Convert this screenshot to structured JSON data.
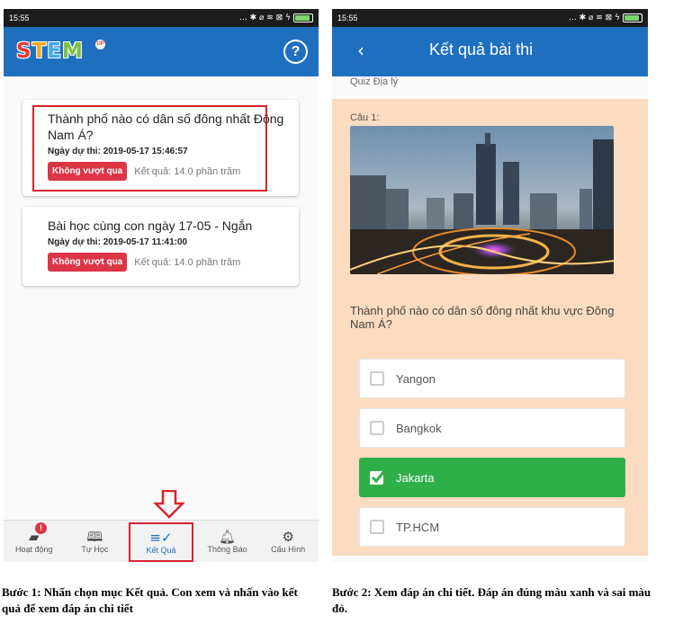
{
  "screen1": {
    "status_time": "15:55",
    "status_icons": "... ✱ ⌀ ≋ ⊠ ϟ",
    "logo_text": "STEM",
    "logo_badge": "UP",
    "help_icon_label": "?",
    "results": [
      {
        "title": "Thành phố nào có dân số đông nhất Đông Nam Á?",
        "date_label": "Ngày dự thi:",
        "date_value": "2019-05-17 15:46:57",
        "status": "Không vượt qua",
        "score": "Kết quả: 14.0 phần trăm"
      },
      {
        "title": "Bài học cùng con ngày 17-05 - Ngắn",
        "date_label": "Ngày dự thi:",
        "date_value": "2019-05-17 11:41:00",
        "status": "Không vượt qua",
        "score": "Kết quả: 14.0 phần trăm"
      }
    ],
    "bottom_nav": [
      {
        "label": "Hoạt động",
        "icon": "activity-icon",
        "badge": "!"
      },
      {
        "label": "Tự Học",
        "icon": "book-icon"
      },
      {
        "label": "Kết Quả",
        "icon": "results-icon",
        "active": true
      },
      {
        "label": "Thông Báo",
        "icon": "bell-icon"
      },
      {
        "label": "Cấu Hình",
        "icon": "gear-icon"
      }
    ],
    "caption": "Bước 1: Nhấn chọn mục Kết quả. Con xem và nhấn vào kết quả để xem đáp án chi tiết"
  },
  "screen2": {
    "status_time": "15:55",
    "status_icons": "... ✱ ⌀ ≋ ⊠ ϟ",
    "title": "Kết quả bài thi",
    "quiz_name": "Quiz Địa lý",
    "question_number": "Câu 1:",
    "question": "Thành phố nào có dân số đông nhất khu vực Đông Nam Á?",
    "options": [
      {
        "label": "Yangon",
        "correct": false
      },
      {
        "label": "Bangkok",
        "correct": false
      },
      {
        "label": "Jakarta",
        "correct": true
      },
      {
        "label": "TP.HCM",
        "correct": false
      }
    ],
    "caption": "Bước 2: Xem đáp án chi tiết. Đáp án đúng màu xanh và sai màu đỏ."
  },
  "colors": {
    "primary": "#1f6fbf",
    "fail_badge": "#dc3545",
    "correct": "#2eaf4a",
    "highlight": "#d9232d",
    "quiz_bg": "#fbdcc0"
  }
}
